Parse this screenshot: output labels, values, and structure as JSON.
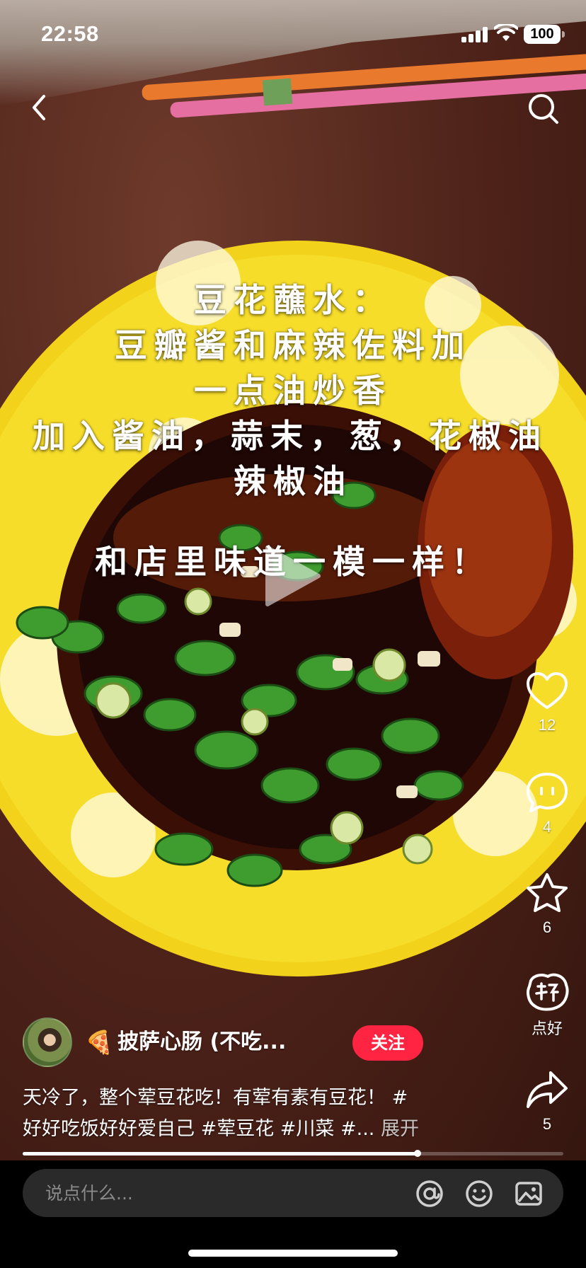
{
  "status_bar": {
    "time": "22:58",
    "battery": "100"
  },
  "overlay_text": {
    "lines": [
      "豆花蘸水：",
      "豆瓣酱和麻辣佐料加",
      "一点油炒香",
      "加入酱油，蒜末，葱，花椒油",
      "辣椒油",
      "和店里味道一模一样！"
    ]
  },
  "actions": {
    "like_count": "12",
    "comment_count": "4",
    "star_count": "6",
    "good_label": "点好",
    "share_count": "5"
  },
  "author": {
    "emoji": "🍕",
    "name": "披萨心肠 (不吃...",
    "follow_label": "关注"
  },
  "description": {
    "line1": "天冷了，整个荤豆花吃！有荤有素有豆花！ #",
    "line2": "好好吃饭好好爱自己 #荤豆花 #川菜 #...",
    "expand": "展开"
  },
  "progress": {
    "fraction": 0.73
  },
  "comment_bar": {
    "placeholder": "说点什么..."
  },
  "icons": {
    "back": "back-arrow-icon",
    "search": "search-icon",
    "like": "heart-icon",
    "comment": "comment-bubble-icon",
    "star": "star-icon",
    "good": "good-badge-icon",
    "share": "share-arrow-icon",
    "mention": "at-sign-icon",
    "emoji": "emoji-face-icon",
    "image": "image-icon"
  },
  "colors": {
    "follow": "#ff2442",
    "bowl": "#f2d21b"
  }
}
